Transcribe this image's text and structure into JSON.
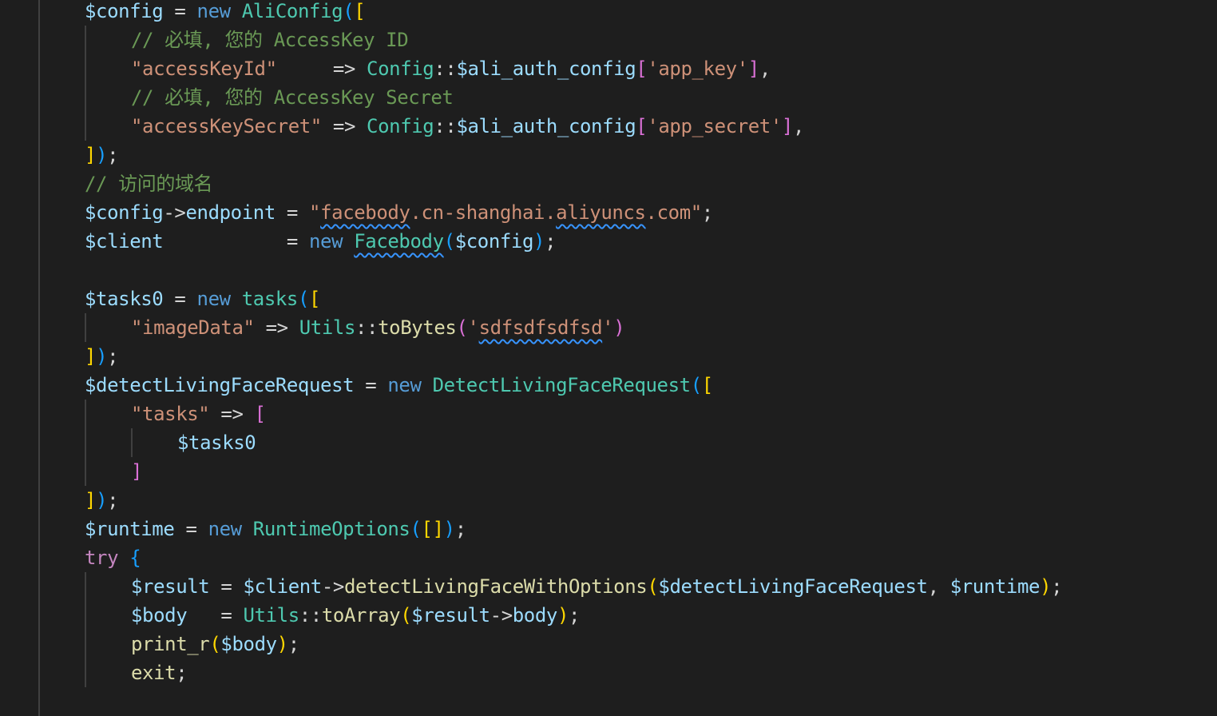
{
  "editor": {
    "lines": [
      {
        "indent": 1,
        "tokens": [
          {
            "t": "$config",
            "c": "var"
          },
          {
            "t": " = ",
            "c": "op"
          },
          {
            "t": "new",
            "c": "kw"
          },
          {
            "t": " "
          },
          {
            "t": "AliConfig",
            "c": "cls"
          },
          {
            "t": "(",
            "c": "b2"
          },
          {
            "t": "[",
            "c": "b1"
          }
        ]
      },
      {
        "indent": 2,
        "tokens": [
          {
            "t": "// 必填, 您的 AccessKey ID",
            "c": "cm"
          }
        ]
      },
      {
        "indent": 2,
        "tokens": [
          {
            "t": "\"accessKeyId\"",
            "c": "str"
          },
          {
            "t": "     => ",
            "c": "op"
          },
          {
            "t": "Config",
            "c": "cls"
          },
          {
            "t": "::",
            "c": "op"
          },
          {
            "t": "$ali_auth_config",
            "c": "var"
          },
          {
            "t": "[",
            "c": "b3"
          },
          {
            "t": "'app_key'",
            "c": "str"
          },
          {
            "t": "]",
            "c": "b3"
          },
          {
            "t": ",",
            "c": "op"
          }
        ]
      },
      {
        "indent": 2,
        "tokens": [
          {
            "t": "// 必填, 您的 AccessKey Secret",
            "c": "cm"
          }
        ]
      },
      {
        "indent": 2,
        "tokens": [
          {
            "t": "\"accessKeySecret\"",
            "c": "str"
          },
          {
            "t": " => ",
            "c": "op"
          },
          {
            "t": "Config",
            "c": "cls"
          },
          {
            "t": "::",
            "c": "op"
          },
          {
            "t": "$ali_auth_config",
            "c": "var"
          },
          {
            "t": "[",
            "c": "b3"
          },
          {
            "t": "'app_secret'",
            "c": "str"
          },
          {
            "t": "]",
            "c": "b3"
          },
          {
            "t": ",",
            "c": "op"
          }
        ]
      },
      {
        "indent": 1,
        "tokens": [
          {
            "t": "]",
            "c": "b1"
          },
          {
            "t": ")",
            "c": "b2"
          },
          {
            "t": ";",
            "c": "op"
          }
        ]
      },
      {
        "indent": 1,
        "tokens": [
          {
            "t": "// 访问的域名",
            "c": "cm"
          }
        ]
      },
      {
        "indent": 1,
        "tokens": [
          {
            "t": "$config",
            "c": "var"
          },
          {
            "t": "->",
            "c": "op"
          },
          {
            "t": "endpoint",
            "c": "var"
          },
          {
            "t": " = ",
            "c": "op"
          },
          {
            "t": "\"",
            "c": "str"
          },
          {
            "t": "facebody",
            "c": "str",
            "sq": true
          },
          {
            "t": ".cn-shanghai.",
            "c": "str"
          },
          {
            "t": "aliyuncs",
            "c": "str",
            "sq": true
          },
          {
            "t": ".com\"",
            "c": "str"
          },
          {
            "t": ";",
            "c": "op"
          }
        ]
      },
      {
        "indent": 1,
        "tokens": [
          {
            "t": "$client",
            "c": "var"
          },
          {
            "t": "           = ",
            "c": "op"
          },
          {
            "t": "new",
            "c": "kw"
          },
          {
            "t": " "
          },
          {
            "t": "Facebody",
            "c": "cls",
            "sq": true
          },
          {
            "t": "(",
            "c": "b2"
          },
          {
            "t": "$config",
            "c": "var"
          },
          {
            "t": ")",
            "c": "b2"
          },
          {
            "t": ";",
            "c": "op"
          }
        ]
      },
      {
        "indent": 0,
        "tokens": []
      },
      {
        "indent": 1,
        "tokens": [
          {
            "t": "$tasks0",
            "c": "var"
          },
          {
            "t": " = ",
            "c": "op"
          },
          {
            "t": "new",
            "c": "kw"
          },
          {
            "t": " "
          },
          {
            "t": "tasks",
            "c": "cls"
          },
          {
            "t": "(",
            "c": "b2"
          },
          {
            "t": "[",
            "c": "b1"
          }
        ]
      },
      {
        "indent": 2,
        "tokens": [
          {
            "t": "\"imageData\"",
            "c": "str"
          },
          {
            "t": " => ",
            "c": "op"
          },
          {
            "t": "Utils",
            "c": "cls"
          },
          {
            "t": "::",
            "c": "op"
          },
          {
            "t": "toBytes",
            "c": "fn"
          },
          {
            "t": "(",
            "c": "b3"
          },
          {
            "t": "'",
            "c": "str"
          },
          {
            "t": "sdfsdfsdfsd",
            "c": "str",
            "sq": true
          },
          {
            "t": "'",
            "c": "str"
          },
          {
            "t": ")",
            "c": "b3"
          }
        ]
      },
      {
        "indent": 1,
        "tokens": [
          {
            "t": "]",
            "c": "b1"
          },
          {
            "t": ")",
            "c": "b2"
          },
          {
            "t": ";",
            "c": "op"
          }
        ]
      },
      {
        "indent": 1,
        "tokens": [
          {
            "t": "$detectLivingFaceRequest",
            "c": "var"
          },
          {
            "t": " = ",
            "c": "op"
          },
          {
            "t": "new",
            "c": "kw"
          },
          {
            "t": " "
          },
          {
            "t": "DetectLivingFaceRequest",
            "c": "cls"
          },
          {
            "t": "(",
            "c": "b2"
          },
          {
            "t": "[",
            "c": "b1"
          }
        ]
      },
      {
        "indent": 2,
        "tokens": [
          {
            "t": "\"tasks\"",
            "c": "str"
          },
          {
            "t": " => ",
            "c": "op"
          },
          {
            "t": "[",
            "c": "b3"
          }
        ]
      },
      {
        "indent": 3,
        "tokens": [
          {
            "t": "$tasks0",
            "c": "var"
          }
        ]
      },
      {
        "indent": 2,
        "tokens": [
          {
            "t": "]",
            "c": "b3"
          }
        ]
      },
      {
        "indent": 1,
        "tokens": [
          {
            "t": "]",
            "c": "b1"
          },
          {
            "t": ")",
            "c": "b2"
          },
          {
            "t": ";",
            "c": "op"
          }
        ]
      },
      {
        "indent": 1,
        "tokens": [
          {
            "t": "$runtime",
            "c": "var"
          },
          {
            "t": " = ",
            "c": "op"
          },
          {
            "t": "new",
            "c": "kw"
          },
          {
            "t": " "
          },
          {
            "t": "RuntimeOptions",
            "c": "cls"
          },
          {
            "t": "(",
            "c": "b2"
          },
          {
            "t": "[]",
            "c": "b1"
          },
          {
            "t": ")",
            "c": "b2"
          },
          {
            "t": ";",
            "c": "op"
          }
        ]
      },
      {
        "indent": 1,
        "tokens": [
          {
            "t": "try",
            "c": "ctl"
          },
          {
            "t": " "
          },
          {
            "t": "{",
            "c": "b2"
          }
        ]
      },
      {
        "indent": 2,
        "tokens": [
          {
            "t": "$result",
            "c": "var"
          },
          {
            "t": " = ",
            "c": "op"
          },
          {
            "t": "$client",
            "c": "var"
          },
          {
            "t": "->",
            "c": "op"
          },
          {
            "t": "detectLivingFaceWithOptions",
            "c": "fn"
          },
          {
            "t": "(",
            "c": "b1"
          },
          {
            "t": "$detectLivingFaceRequest",
            "c": "var"
          },
          {
            "t": ", ",
            "c": "op"
          },
          {
            "t": "$runtime",
            "c": "var"
          },
          {
            "t": ")",
            "c": "b1"
          },
          {
            "t": ";",
            "c": "op"
          }
        ]
      },
      {
        "indent": 2,
        "tokens": [
          {
            "t": "$body",
            "c": "var"
          },
          {
            "t": "   = ",
            "c": "op"
          },
          {
            "t": "Utils",
            "c": "cls"
          },
          {
            "t": "::",
            "c": "op"
          },
          {
            "t": "toArray",
            "c": "fn"
          },
          {
            "t": "(",
            "c": "b1"
          },
          {
            "t": "$result",
            "c": "var"
          },
          {
            "t": "->",
            "c": "op"
          },
          {
            "t": "body",
            "c": "var"
          },
          {
            "t": ")",
            "c": "b1"
          },
          {
            "t": ";",
            "c": "op"
          }
        ]
      },
      {
        "indent": 2,
        "tokens": [
          {
            "t": "print_r",
            "c": "fn"
          },
          {
            "t": "(",
            "c": "b1"
          },
          {
            "t": "$body",
            "c": "var"
          },
          {
            "t": ")",
            "c": "b1"
          },
          {
            "t": ";",
            "c": "op"
          }
        ]
      },
      {
        "indent": 2,
        "tokens": [
          {
            "t": "exit",
            "c": "fn"
          },
          {
            "t": ";",
            "c": "op"
          }
        ]
      }
    ]
  },
  "colors": {
    "background": "#1e1e1e",
    "guide": "#404040",
    "squiggle": "#3794ff"
  }
}
